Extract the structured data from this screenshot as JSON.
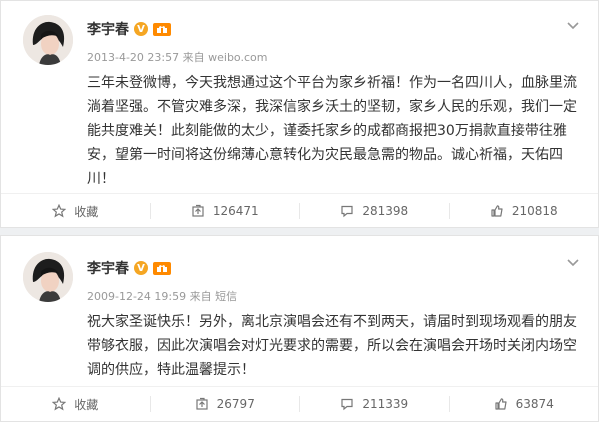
{
  "posts": [
    {
      "author": "李宇春",
      "badge_v": "V",
      "timestamp": "2013-4-20 23:57",
      "source_prefix": "来自",
      "source": "weibo.com",
      "text": "三年未登微博，今天我想通过这个平台为家乡祈福！作为一名四川人，血脉里流淌着坚强。不管灾难多深，我深信家乡沃土的坚韧，家乡人民的乐观，我们一定能共度难关！此刻能做的太少，谨委托家乡的成都商报把30万捐款直接带往雅安，望第一时间将这份绵薄心意转化为灾民最急需的物品。诚心祈福，天佑四川！",
      "actions": {
        "favorite": "收藏",
        "repost": "126471",
        "comment": "281398",
        "like": "210818"
      }
    },
    {
      "author": "李宇春",
      "badge_v": "V",
      "timestamp": "2009-12-24 19:59",
      "source_prefix": "来自",
      "source": "短信",
      "text": "祝大家圣诞快乐！另外，离北京演唱会还有不到两天，请届时到现场观看的朋友带够衣服，因此次演唱会对灯光要求的需要，所以会在演唱会开场时关闭内场空调的供应，特此温馨提示！",
      "actions": {
        "favorite": "收藏",
        "repost": "26797",
        "comment": "211339",
        "like": "63874"
      }
    }
  ],
  "colors": {
    "accent": "#f5a623",
    "meta": "#999999",
    "text": "#333333"
  },
  "icons": [
    "avatar-photo",
    "verified-icon",
    "gift-icon",
    "chevron-down-icon",
    "star-icon",
    "repost-icon",
    "comment-icon",
    "thumb-up-icon"
  ]
}
